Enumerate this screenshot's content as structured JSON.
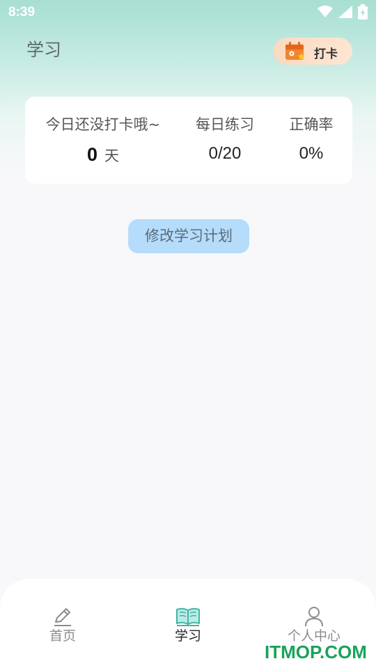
{
  "status_bar": {
    "time": "8:39",
    "icons": [
      "wifi-icon",
      "signal-icon",
      "battery-charging-icon"
    ]
  },
  "header": {
    "title": "学习",
    "checkin_label": "打卡"
  },
  "stats": {
    "streak_label": "今日还没打卡哦~",
    "streak_value": "0",
    "streak_unit": "天",
    "daily_label": "每日练习",
    "daily_value": "0/20",
    "accuracy_label": "正确率",
    "accuracy_value": "0%"
  },
  "edit_plan_label": "修改学习计划",
  "bottom_nav": {
    "items": [
      {
        "label": "首页",
        "icon": "pencil-icon",
        "active": false
      },
      {
        "label": "学习",
        "icon": "book-icon",
        "active": true
      },
      {
        "label": "个人中心",
        "icon": "user-icon",
        "active": false
      }
    ]
  },
  "watermark": "ITMOP.COM",
  "colors": {
    "accent_teal": "#3fb5a8",
    "checkin_bg": "#fbd9c0",
    "button_blue": "#b5dcfb",
    "watermark_green": "#1aa35a"
  }
}
